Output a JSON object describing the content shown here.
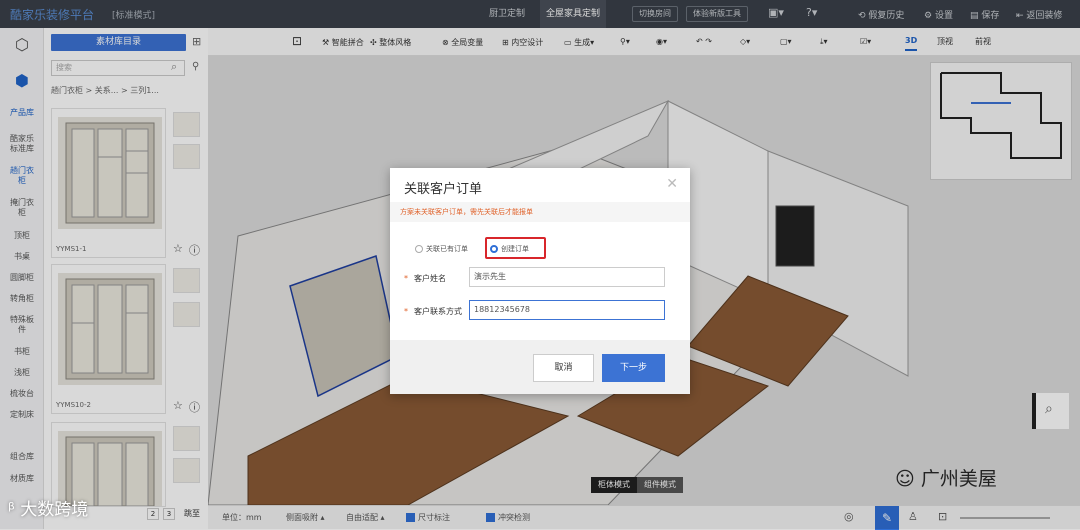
{
  "topbar": {
    "app_title": "酷家乐装修平台",
    "mode_tag": "[标准模式]",
    "tabs": [
      "厨卫定制",
      "全屋家具定制"
    ],
    "buttons": [
      "切换房间",
      "体验新版工具"
    ],
    "actions": [
      "假复历史",
      "设置",
      "保存",
      "返回装修"
    ]
  },
  "rail": {
    "items": [
      "产品库",
      "酷家乐标准库",
      "趟门衣柜",
      "掩门衣柜",
      "顶柜",
      "书桌",
      "圆脚柜",
      "转角柜",
      "特殊板件",
      "书柜",
      "浅柜",
      "梳妆台",
      "定制床",
      "组合库",
      "材质库"
    ]
  },
  "panel": {
    "lib_button": "素材库目录",
    "search_placeholder": "搜索",
    "breadcrumb": "趟门衣柜 > 关系... > 三列1...",
    "products": [
      {
        "label": "YYMS1-1"
      },
      {
        "label": "YYMS10-2"
      }
    ],
    "pager": [
      "2",
      "3"
    ],
    "pager_jump": "跳至"
  },
  "toolbar": {
    "tools": [
      "智能拼合",
      "整体风格",
      "全局变量",
      "内空设计",
      "生成",
      "测量",
      "视图",
      "撤销",
      "清除",
      "背景",
      "导出",
      "检测"
    ],
    "views": [
      "3D",
      "顶视",
      "前视"
    ],
    "active_view": "3D"
  },
  "canvas": {
    "mode_switch": [
      "柜体模式",
      "组件模式"
    ],
    "active_mode": "柜体模式"
  },
  "bottombar": {
    "unit": "单位：mm",
    "items": [
      "侧面吸附",
      "自由适配",
      "尺寸标注",
      "冲突检测"
    ]
  },
  "modal": {
    "title": "关联客户订单",
    "notice": "方案未关联客户订单，需先关联后才能报单",
    "radio_existing": "关联已有订单",
    "radio_create": "创建订单",
    "name_label": "客户姓名",
    "name_value": "演示先生",
    "phone_label": "客户联系方式",
    "phone_value": "18812345678",
    "cancel": "取消",
    "next": "下一步"
  },
  "watermarks": {
    "left": "大数跨境",
    "right": "广州美屋"
  },
  "colors": {
    "accent": "#3c73d4",
    "highlight": "#d8262b",
    "notice": "#e0622a"
  }
}
